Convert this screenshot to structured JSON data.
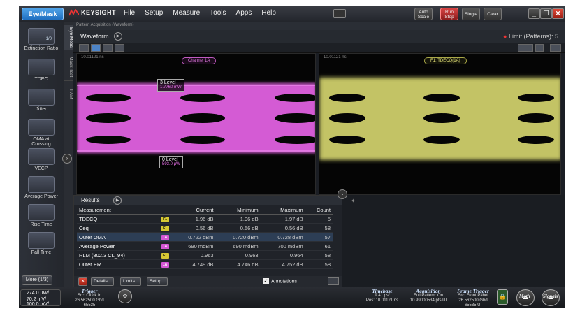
{
  "titlebar": {
    "mode_button": "Eye/Mask",
    "brand": "KEYSIGHT",
    "menu": [
      "File",
      "Setup",
      "Measure",
      "Tools",
      "Apps",
      "Help"
    ],
    "auto_scale": "Auto Scale",
    "run_stop": "Run Stop",
    "single": "Single",
    "clear": "Clear"
  },
  "sidebar": {
    "items": [
      {
        "label": "Extinction Ratio",
        "icon": "extinction-ratio-icon",
        "icon_text": "1/0"
      },
      {
        "label": "TDEC",
        "icon": "tdec-icon"
      },
      {
        "label": "Jitter",
        "icon": "jitter-icon"
      },
      {
        "label": "OMA at Crossing",
        "icon": "oma-crossing-icon"
      },
      {
        "label": "VECP",
        "icon": "vecp-icon"
      },
      {
        "label": "Average Power",
        "icon": "average-power-icon"
      },
      {
        "label": "Rise Time",
        "icon": "rise-time-icon"
      },
      {
        "label": "Fall Time",
        "icon": "fall-time-icon"
      }
    ],
    "more": "More (1/3)"
  },
  "vertical_tabs": [
    "Eye Meas",
    "Mask Test",
    "PAM"
  ],
  "waveform": {
    "bar_label": "Pattern Acquisition   (Waveform)",
    "title": "Waveform",
    "limit_text": "Limit (Patterns): 5",
    "left_timestamp": "10.01121 ns",
    "right_timestamp": "10.01121 ns",
    "left_channel": "Channel 1A",
    "right_channel": "F1: TDECQ(1A)",
    "level3_title": "3 Level",
    "level3_value": "1.7760 mW",
    "level0_title": "0 Level",
    "level0_value": "593.0 µW"
  },
  "results": {
    "title": "Results",
    "columns": [
      "Measurement",
      "",
      "Current",
      "Minimum",
      "Maximum",
      "Count"
    ],
    "rows": [
      {
        "name": "TDECQ",
        "src": "F1",
        "current": "1.96 dB",
        "min": "1.96 dB",
        "max": "1.97 dB",
        "count": "5"
      },
      {
        "name": "Ceq",
        "src": "F1",
        "current": "0.56 dB",
        "min": "0.56 dB",
        "max": "0.56 dB",
        "count": "58"
      },
      {
        "name": "Outer OMA",
        "src": "1A",
        "current": "0.722 dBm",
        "min": "0.720 dBm",
        "max": "0.728 dBm",
        "count": "57"
      },
      {
        "name": "Average Power",
        "src": "1A",
        "current": "690 mdBm",
        "min": "690 mdBm",
        "max": "700 mdBm",
        "count": "61"
      },
      {
        "name": "RLM (802.3 CL_94)",
        "src": "F1",
        "current": "0.963",
        "min": "0.963",
        "max": "0.964",
        "count": "58"
      },
      {
        "name": "Outer ER",
        "src": "1A",
        "current": "4.749 dB",
        "min": "4.746 dB",
        "max": "4.752 dB",
        "count": "58"
      }
    ],
    "footer": {
      "details": "Details...",
      "limits": "Limits...",
      "setup": "Setup...",
      "annotations": "Annotations"
    }
  },
  "statusbar": {
    "ch1": "274.0 µW/",
    "ch2": "70.2 mV/",
    "ch3": "100.0 mV/",
    "trigger_title": "Trigger",
    "trigger_lines": [
      "Src: Clock In",
      "26.562500 Gbd",
      "65535"
    ],
    "timebase_title": "Timebase",
    "timebase_lines": [
      "9.41 ps/",
      "Pos: 10.01121 ns"
    ],
    "acquisition_title": "Acquisition",
    "acquisition_lines": [
      "Full Pattern: On",
      "10.99000534 pts/UI"
    ],
    "frame_title": "Frame Trigger",
    "frame_lines": [
      "Src: Front Panel",
      "26.562500 Gbd",
      "65535 UI"
    ],
    "math": "Math",
    "signals": "Signals"
  },
  "colors": {
    "eye_left": "#e060e0",
    "eye_right": "#e8e880",
    "accent": "#1f6fc0"
  }
}
